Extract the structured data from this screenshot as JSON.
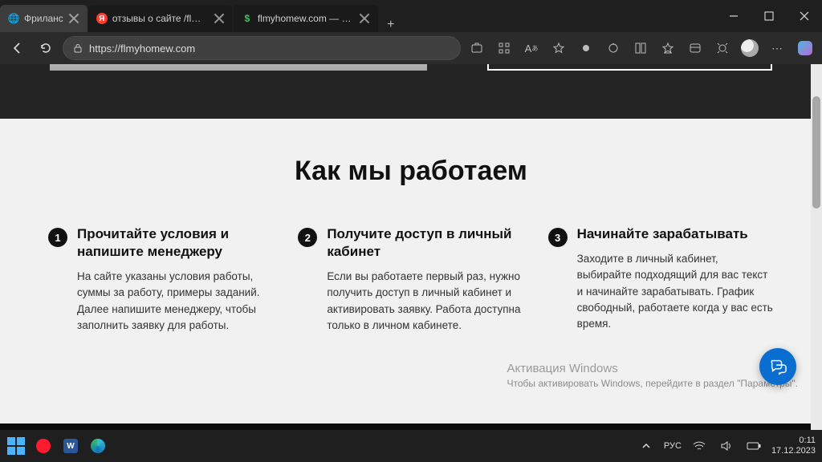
{
  "browser": {
    "tabs": [
      {
        "label": "Фриланс",
        "favicon": "globe",
        "active": true
      },
      {
        "label": "отзывы о сайте /flmyhomew.com",
        "favicon": "yandex",
        "active": false
      },
      {
        "label": "flmyhomew.com — Опасный на",
        "favicon": "dollar",
        "active": false
      }
    ],
    "new_tab": "+",
    "url": "https://flmyhomew.com",
    "protocol_lock": "🔒"
  },
  "page": {
    "heading": "Как мы работаем",
    "steps": [
      {
        "num": "1",
        "title": "Прочитайте условия и напишите менеджеру",
        "desc": "На сайте указаны условия работы, суммы за работу, примеры заданий. Далее напишите менеджеру, чтобы заполнить заявку для работы."
      },
      {
        "num": "2",
        "title": "Получите доступ в личный кабинет",
        "desc": "Если вы работаете первый раз, нужно получить доступ в личный кабинет и активировать заявку. Работа доступна только в личном кабинете."
      },
      {
        "num": "3",
        "title": "Начинайте зарабатывать",
        "desc": "Заходите в личный кабинет, выбирайте подходящий для вас текст и начинайте зарабатывать. График свободный, работаете когда у вас есть время."
      }
    ]
  },
  "watermark": {
    "title": "Активация Windows",
    "sub": "Чтобы активировать Windows, перейдите в раздел \"Параметры\"."
  },
  "taskbar": {
    "lang": "РУС",
    "time": "0:11",
    "date": "17.12.2023"
  }
}
